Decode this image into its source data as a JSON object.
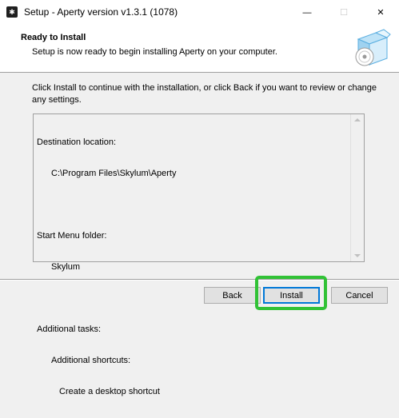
{
  "window": {
    "title": "Setup - Aperty version v1.3.1 (1078)",
    "app_icon_glyph": "✱",
    "controls": {
      "minimize": "—",
      "maximize": "☐",
      "close": "✕"
    }
  },
  "header": {
    "title": "Ready to Install",
    "subtitle": "Setup is now ready to begin installing Aperty on your computer.",
    "icon": "setup-box-disc-icon"
  },
  "description": "Click Install to continue with the installation, or click Back if you want to review or change any settings.",
  "summary": {
    "destination_label": "Destination location:",
    "destination_value": "C:\\Program Files\\Skylum\\Aperty",
    "start_menu_label": "Start Menu folder:",
    "start_menu_value": "Skylum",
    "tasks_label": "Additional tasks:",
    "tasks_group": "Additional shortcuts:",
    "tasks_item": "Create a desktop shortcut"
  },
  "buttons": {
    "back": "Back",
    "install": "Install",
    "cancel": "Cancel"
  },
  "colors": {
    "highlight": "#31c236",
    "focus": "#0078d7"
  }
}
